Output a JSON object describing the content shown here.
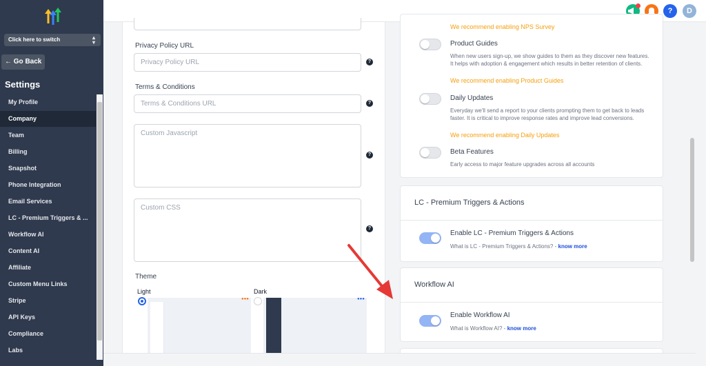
{
  "sidebar": {
    "switcher_label": "Click here to switch",
    "go_back": "← Go Back",
    "title": "Settings",
    "items": [
      {
        "label": "My Profile"
      },
      {
        "label": "Company"
      },
      {
        "label": "Team"
      },
      {
        "label": "Billing"
      },
      {
        "label": "Snapshot"
      },
      {
        "label": "Phone Integration"
      },
      {
        "label": "Email Services"
      },
      {
        "label": "LC - Premium Triggers & ..."
      },
      {
        "label": "Workflow AI"
      },
      {
        "label": "Content AI"
      },
      {
        "label": "Affiliate"
      },
      {
        "label": "Custom Menu Links"
      },
      {
        "label": "Stripe"
      },
      {
        "label": "API Keys"
      },
      {
        "label": "Compliance"
      },
      {
        "label": "Labs"
      }
    ],
    "active_item": "Company"
  },
  "topbar": {
    "avatar_initial": "D",
    "help_glyph": "?",
    "colors": {
      "megaphone": "#10b981",
      "bell": "#f97316",
      "help": "#2563eb",
      "avatar": "#93b4d8",
      "notification_dot": "#ef4444"
    }
  },
  "form": {
    "privacy_label": "Privacy Policy URL",
    "privacy_placeholder": "Privacy Policy URL",
    "terms_label": "Terms & Conditions",
    "terms_placeholder": "Terms & Conditions URL",
    "js_placeholder": "Custom Javascript",
    "css_placeholder": "Custom CSS",
    "help_glyph": "?",
    "theme_label": "Theme",
    "theme_light": "Light",
    "theme_dark": "Dark",
    "selected_theme": "Light"
  },
  "features": {
    "nps_recommend": "We recommend enabling NPS Survey",
    "product_guides": {
      "title": "Product Guides",
      "desc": "When new users sign-up, we show guides to them as they discover new features. It helps with adoption & engagement which results in better retention of clients.",
      "recommend": "We recommend enabling Product Guides",
      "enabled": false
    },
    "daily_updates": {
      "title": "Daily Updates",
      "desc": "Everyday we'll send a report to your clients prompting them to get back to leads faster. It is critical to improve response rates and improve lead conversions.",
      "recommend": "We recommend enabling Daily Updates",
      "enabled": false
    },
    "beta": {
      "title": "Beta Features",
      "desc": "Early access to major feature upgrades across all accounts",
      "enabled": false
    }
  },
  "lc_card": {
    "title": "LC - Premium Triggers & Actions",
    "toggle_label": "Enable LC - Premium Triggers & Actions",
    "desc": "What is LC - Premium Triggers & Actions? -",
    "know_more": "know more",
    "enabled": true
  },
  "workflow_card": {
    "title": "Workflow AI",
    "toggle_label": "Enable Workflow AI",
    "desc": "What is Workflow AI? -",
    "know_more": "know more",
    "enabled": true
  },
  "colors": {
    "sidebar_bg": "#2f3a4e",
    "toggle_on": "#93b4f5",
    "recommend": "#f59e0b",
    "link": "#1d4ed8",
    "annotation_arrow": "#e53935"
  }
}
